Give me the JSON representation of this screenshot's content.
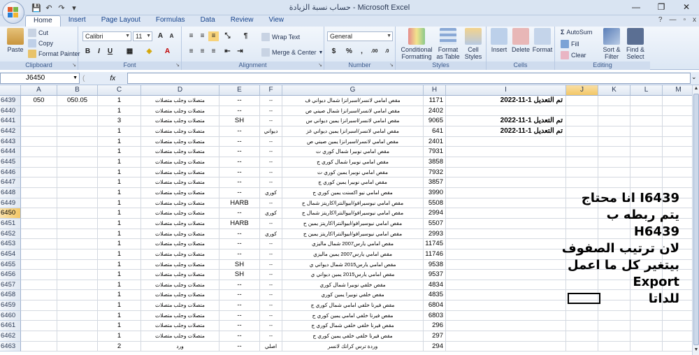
{
  "window": {
    "title": "حساب نسبة الزيادة - Microsoft Excel",
    "minimize": "—",
    "restore": "❐",
    "close": "✕"
  },
  "qat": {
    "save": "💾",
    "undo": "↶",
    "redo": "↷",
    "more": "▾"
  },
  "tabs": [
    "Home",
    "Insert",
    "Page Layout",
    "Formulas",
    "Data",
    "Review",
    "View"
  ],
  "tab_right": {
    "help": "?",
    "min": "—",
    "restore": "▫",
    "close": "x"
  },
  "ribbon": {
    "clipboard": {
      "label": "Clipboard",
      "paste": "Paste",
      "cut": "Cut",
      "copy": "Copy",
      "format_painter": "Format Painter"
    },
    "font": {
      "label": "Font",
      "name": "Calibri",
      "size": "11",
      "grow": "A",
      "shrink": "A",
      "bold": "B",
      "italic": "I",
      "underline": "U"
    },
    "alignment": {
      "label": "Alignment",
      "wrap": "Wrap Text",
      "merge": "Merge & Center"
    },
    "number": {
      "label": "Number",
      "format": "General",
      "currency": "$",
      "percent": "%",
      "comma": ",",
      "inc_dec": ".00",
      "dec_dec": ".0"
    },
    "styles": {
      "label": "Styles",
      "conditional": "Conditional Formatting",
      "format_table": "Format as Table",
      "cell_styles": "Cell Styles"
    },
    "cells": {
      "label": "Cells",
      "insert": "Insert",
      "delete": "Delete",
      "format": "Format"
    },
    "editing": {
      "label": "Editing",
      "autosum": "AutoSum",
      "fill": "Fill",
      "clear": "Clear",
      "sort": "Sort & Filter",
      "find": "Find & Select"
    }
  },
  "formula_bar": {
    "name_box": "J6450",
    "fx": "fx",
    "value": ""
  },
  "columns": [
    "A",
    "B",
    "C",
    "D",
    "E",
    "F",
    "G",
    "H",
    "I",
    "J",
    "K",
    "L",
    "M"
  ],
  "selected_column": "J",
  "selected_row": "6450",
  "rows": [
    {
      "n": "6439",
      "a": "050",
      "b": "050.05",
      "c": "1",
      "d": "متصلات وجلب متصلات",
      "e": "--",
      "f": "--",
      "g": "مقص امامي لانسر/اسبرانزا شمال ديواني ف",
      "h": "1171",
      "i": "تم التعديل 1-11-2022"
    },
    {
      "n": "6440",
      "a": "",
      "b": "",
      "c": "1",
      "d": "متصلات وجلب متصلات",
      "e": "--",
      "f": "--",
      "g": "مقص امامي لانسر/اسبرانزا شمال صيني ص",
      "h": "2402",
      "i": ""
    },
    {
      "n": "6441",
      "a": "",
      "b": "",
      "c": "3",
      "d": "متصلات وجلب متصلات",
      "e": "SH",
      "f": "--",
      "g": "مقص امامي لانسر/اسبرانزا يمين ديواني س",
      "h": "9065",
      "i": "تم التعديل 1-11-2022"
    },
    {
      "n": "6442",
      "a": "",
      "b": "",
      "c": "1",
      "d": "متصلات وجلب متصلات",
      "e": "--",
      "f": "ديواني",
      "g": "مقص امامي لانسر/اسبرانزا يمين ديواني غز",
      "h": "641",
      "i": "تم التعديل 1-11-2022"
    },
    {
      "n": "6443",
      "a": "",
      "b": "",
      "c": "1",
      "d": "متصلات وجلب متصلات",
      "e": "--",
      "f": "--",
      "g": "مقص امامي لانسر/اسبرانزا يمين صيني ص",
      "h": "2401",
      "i": ""
    },
    {
      "n": "6444",
      "a": "",
      "b": "",
      "c": "1",
      "d": "متصلات وجلب متصلات",
      "e": "--",
      "f": "--",
      "g": "مقص امامي نوبيرا شمال كوري ت",
      "h": "7931",
      "i": ""
    },
    {
      "n": "6445",
      "a": "",
      "b": "",
      "c": "1",
      "d": "متصلات وجلب متصلات",
      "e": "--",
      "f": "--",
      "g": "مقص امامي نوبيرا شمال كوري ج",
      "h": "3858",
      "i": ""
    },
    {
      "n": "6446",
      "a": "",
      "b": "",
      "c": "1",
      "d": "متصلات وجلب متصلات",
      "e": "--",
      "f": "--",
      "g": "مقص امامي نوبيرا يمين كوري ت",
      "h": "7932",
      "i": ""
    },
    {
      "n": "6447",
      "a": "",
      "b": "",
      "c": "1",
      "d": "متصلات وجلب متصلات",
      "e": "--",
      "f": "--",
      "g": "مقص امامي نوبيرا يمين كوري ج",
      "h": "3857",
      "i": ""
    },
    {
      "n": "6448",
      "a": "",
      "b": "",
      "c": "1",
      "d": "متصلات وجلب متصلات",
      "e": "--",
      "f": "كوري",
      "g": "مقص امامي نيو اكسنت يمين كوري ج",
      "h": "3990",
      "i": ""
    },
    {
      "n": "6449",
      "a": "",
      "b": "",
      "c": "1",
      "d": "متصلات وجلب متصلات",
      "e": "HARB",
      "f": "--",
      "g": "مقص امامي نيوسيرافو/ابيوالنترا/كاريتز شمال ح",
      "h": "5508",
      "i": ""
    },
    {
      "n": "6450",
      "a": "",
      "b": "",
      "c": "1",
      "d": "متصلات وجلب متصلات",
      "e": "--",
      "f": "كوري",
      "g": "مقص امامي نيوسيرافو/ابيوالنترا/كاريتز شمال ج",
      "h": "2994",
      "i": ""
    },
    {
      "n": "6451",
      "a": "",
      "b": "",
      "c": "1",
      "d": "متصلات وجلب متصلات",
      "e": "HARB",
      "f": "--",
      "g": "مقص امامي نيوسيرافو/ابيوالنترا/كاريتز يمين ح",
      "h": "5507",
      "i": ""
    },
    {
      "n": "6452",
      "a": "",
      "b": "",
      "c": "1",
      "d": "متصلات وجلب متصلات",
      "e": "--",
      "f": "كوري",
      "g": "مقص امامي نيوسيرافو/ابيوالنترا/كاريتز يمين ج",
      "h": "2993",
      "i": ""
    },
    {
      "n": "6453",
      "a": "",
      "b": "",
      "c": "1",
      "d": "متصلات وجلب متصلات",
      "e": "--",
      "f": "--",
      "g": "مقص امامي يارس2007 شمال ماليزي",
      "h": "11745",
      "i": ""
    },
    {
      "n": "6454",
      "a": "",
      "b": "",
      "c": "1",
      "d": "متصلات وجلب متصلات",
      "e": "--",
      "f": "--",
      "g": "مقص امامي يارس2007 يمين ماليزي",
      "h": "11746",
      "i": ""
    },
    {
      "n": "6455",
      "a": "",
      "b": "",
      "c": "1",
      "d": "متصلات وجلب متصلات",
      "e": "SH",
      "f": "--",
      "g": "مقص امامي يارس2015 شمال ديواني ي",
      "h": "9538",
      "i": ""
    },
    {
      "n": "6456",
      "a": "",
      "b": "",
      "c": "1",
      "d": "متصلات وجلب متصلات",
      "e": "SH",
      "f": "--",
      "g": "مقص امامي يارس2015 يمين ديواني ي",
      "h": "9537",
      "i": ""
    },
    {
      "n": "6457",
      "a": "",
      "b": "",
      "c": "1",
      "d": "متصلات وجلب متصلات",
      "e": "--",
      "f": "--",
      "g": "مقص خلفي نوبيرا شمال كوري",
      "h": "4834",
      "i": ""
    },
    {
      "n": "6458",
      "a": "",
      "b": "",
      "c": "1",
      "d": "متصلات وجلب متصلات",
      "e": "--",
      "f": "--",
      "g": "مقص خلفي نوبيرا يمين كوري",
      "h": "4835",
      "i": ""
    },
    {
      "n": "6459",
      "a": "",
      "b": "",
      "c": "1",
      "d": "متصلات وجلب متصلات",
      "e": "--",
      "f": "--",
      "g": "مقص فيرنا خلفي امامي شمال كوري ج",
      "h": "6804",
      "i": ""
    },
    {
      "n": "6460",
      "a": "",
      "b": "",
      "c": "1",
      "d": "متصلات وجلب متصلات",
      "e": "--",
      "f": "--",
      "g": "مقص فيرنا خلفي امامي يمين كوري ج",
      "h": "6803",
      "i": ""
    },
    {
      "n": "6461",
      "a": "",
      "b": "",
      "c": "1",
      "d": "متصلات وجلب متصلات",
      "e": "--",
      "f": "--",
      "g": "مقص فيرنا خلفي خلفي شمال كوري ج",
      "h": "296",
      "i": ""
    },
    {
      "n": "6462",
      "a": "",
      "b": "",
      "c": "1",
      "d": "متصلات وجلب متصلات",
      "e": "--",
      "f": "--",
      "g": "مقص فيرنا خلفي خلفي يمين كوري ج",
      "h": "297",
      "i": ""
    },
    {
      "n": "6463",
      "a": "",
      "b": "",
      "c": "2",
      "d": "ورد",
      "e": "--",
      "f": "اصلي",
      "g": "وردة ترس كرانك لانسر",
      "h": "294",
      "i": ""
    }
  ],
  "annotation": "I6439 انا محتاج\nيتم ربطه ب\nH6439\nلان ترتيب الصفوف\nبيتغير كل ما اعمل Export\nللداتا",
  "colors": {
    "title_bg": "#d9e4f2",
    "ribbon_bg": "#dce7f4",
    "selected_header": "#f3c766",
    "grid_line": "#d4d9e1"
  }
}
